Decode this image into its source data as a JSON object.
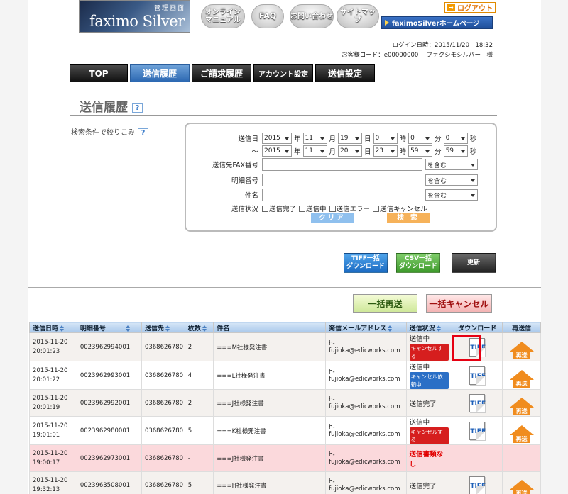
{
  "header": {
    "logo_sub": "管理画面",
    "logo_main": "faximo Silver",
    "manual_label": "オンライン\nマニュアル",
    "faq_label": "FAQ",
    "contact_label": "お問い合わせ",
    "sitemap_label": "サイトマップ",
    "logout_label": "ログアウト",
    "home_label": "faximoSilverホームページ",
    "login_datetime": "ログイン日時：2015/11/20　18:32",
    "customer_line": "お客様コード：e00000000　 ファクシモシルバー　様"
  },
  "nav": [
    {
      "label": "TOP",
      "active": false
    },
    {
      "label": "送信履歴",
      "active": true
    },
    {
      "label": "ご請求履歴",
      "active": false
    },
    {
      "label": "アカウント設定",
      "active": false
    },
    {
      "label": "送信設定",
      "active": false
    }
  ],
  "page_title": "送信履歴",
  "help_glyph": "?",
  "filter_label": "検索条件で絞りこみ",
  "search": {
    "date_label": "送信日",
    "range_sep": "〜",
    "from": {
      "year": "2015",
      "month": "11",
      "day": "19",
      "hour": "0",
      "min": "0",
      "sec": "0"
    },
    "to": {
      "year": "2015",
      "month": "11",
      "day": "20",
      "hour": "23",
      "min": "59",
      "sec": "59"
    },
    "units": {
      "year": "年",
      "month": "月",
      "day": "日",
      "hour": "時",
      "min": "分",
      "sec": "秒"
    },
    "fax_label": "送信先FAX番号",
    "detail_label": "明細番号",
    "subject_label": "件名",
    "match_option": "を含む",
    "status_label": "送信状況",
    "status_options": [
      "送信完了",
      "送信中",
      "送信エラー",
      "送信キャンセル"
    ],
    "clear_label": "クリア",
    "search_label": "検 索"
  },
  "actions": {
    "tiff_bulk": "TIFF一括\nダウンロード",
    "csv_bulk": "CSV一括\nダウンロード",
    "refresh": "更新",
    "bulk_resend": "一括再送",
    "bulk_cancel": "一括キャンセル"
  },
  "table": {
    "headers": [
      "送信日時",
      "明細番号",
      "送信先",
      "枚数",
      "件名",
      "発信メールアドレス",
      "送信状況",
      "ダウンロード",
      "再送信"
    ],
    "tiff_label": "TIFF",
    "resend_label": "再送",
    "rows": [
      {
        "date": "2015-11-20",
        "time": "20:01:23",
        "id": "0023962994001",
        "dest": "0368626780",
        "pages": "2",
        "subject": "===M社様発注書",
        "email": "h-fujioka@edicworks.com",
        "status": "送信中",
        "badge": "キャンセルする",
        "badge_type": "cancel",
        "tiff": true,
        "resend": true,
        "kind": "r0"
      },
      {
        "date": "2015-11-20",
        "time": "20:01:22",
        "id": "0023962993001",
        "dest": "0368626780",
        "pages": "4",
        "subject": "===L社様発注書",
        "email": "h-fujioka@edicworks.com",
        "status": "送信中",
        "badge": "キャンセル依頼中",
        "badge_type": "pend",
        "tiff": true,
        "resend": true,
        "kind": "r1"
      },
      {
        "date": "2015-11-20",
        "time": "20:01:19",
        "id": "0023962992001",
        "dest": "0368626780",
        "pages": "2",
        "subject": "===J社様発注書",
        "email": "h-fujioka@edicworks.com",
        "status": "送信完了",
        "badge": "",
        "badge_type": "",
        "tiff": true,
        "resend": true,
        "kind": "r0"
      },
      {
        "date": "2015-11-20",
        "time": "19:01:01",
        "id": "0023962980001",
        "dest": "0368626780",
        "pages": "5",
        "subject": "===K社様発注書",
        "email": "h-fujioka@edicworks.com",
        "status": "送信中",
        "badge": "キャンセルする",
        "badge_type": "cancel",
        "tiff": true,
        "resend": true,
        "kind": "r1"
      },
      {
        "date": "2015-11-20",
        "time": "19:00:17",
        "id": "0023962973001",
        "dest": "0368626780",
        "pages": "-",
        "subject": "===J社様発注書",
        "email": "h-fujioka@edicworks.com",
        "status": "送信書類なし",
        "badge": "",
        "badge_type": "",
        "tiff": false,
        "resend": false,
        "kind": "err"
      },
      {
        "date": "2015-11-20",
        "time": "19:32:13",
        "id": "0023963508001",
        "dest": "0368626780",
        "pages": "5",
        "subject": "===H社様発注書",
        "email": "h-fujioka@edicworks.com",
        "status": "送信完了",
        "badge": "",
        "badge_type": "",
        "tiff": true,
        "resend": true,
        "kind": "r0"
      }
    ]
  }
}
